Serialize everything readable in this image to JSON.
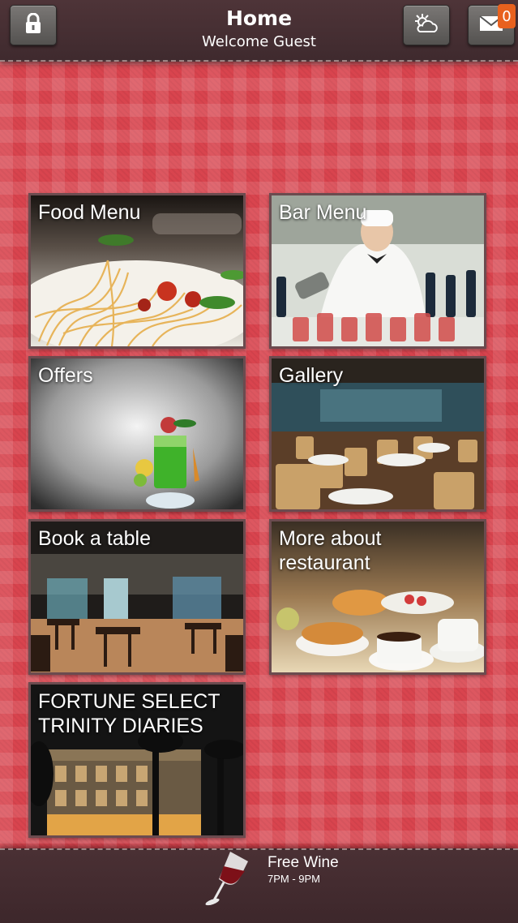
{
  "header": {
    "title": "Home",
    "subtitle": "Welcome Guest",
    "lock_icon": "lock-icon",
    "weather_icon": "sun-cloud-icon",
    "mail_icon": "mail-icon",
    "mail_badge": "0"
  },
  "tiles": [
    {
      "label": "Food Menu"
    },
    {
      "label": "Bar Menu"
    },
    {
      "label": "Offers"
    },
    {
      "label": "Gallery"
    },
    {
      "label": "Book a table"
    },
    {
      "label": "More about restaurant"
    },
    {
      "label": "FORTUNE SELECT TRINITY DIARIES"
    }
  ],
  "footer": {
    "promo_title": "Free Wine",
    "promo_time": "7PM - 9PM",
    "icon": "wine-glass-icon"
  },
  "colors": {
    "background": "#d9444e",
    "header": "#4e3438",
    "badge": "#e8611e"
  }
}
